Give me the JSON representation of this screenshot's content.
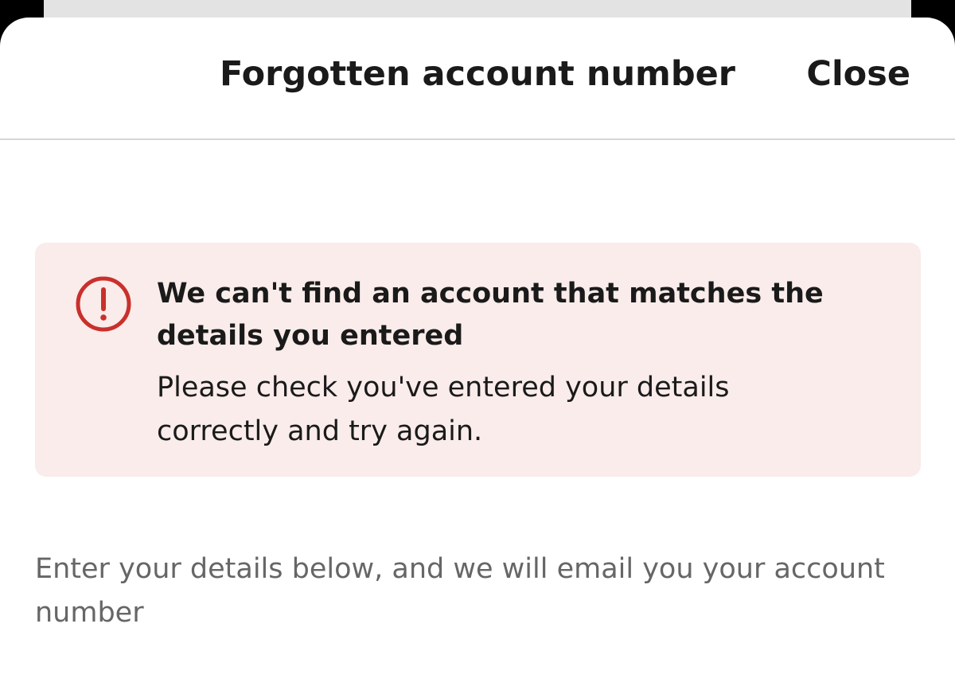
{
  "header": {
    "title": "Forgotten account number",
    "close_label": "Close"
  },
  "alert": {
    "icon": "exclamation-circle-icon",
    "icon_color": "#c9302c",
    "background_color": "#f9ecea",
    "title": "We can't find an account that matches the details you entered",
    "body": "Please check you've entered your details correctly and try again."
  },
  "content": {
    "intro_text": "Enter your details below, and we will email you your account number"
  }
}
